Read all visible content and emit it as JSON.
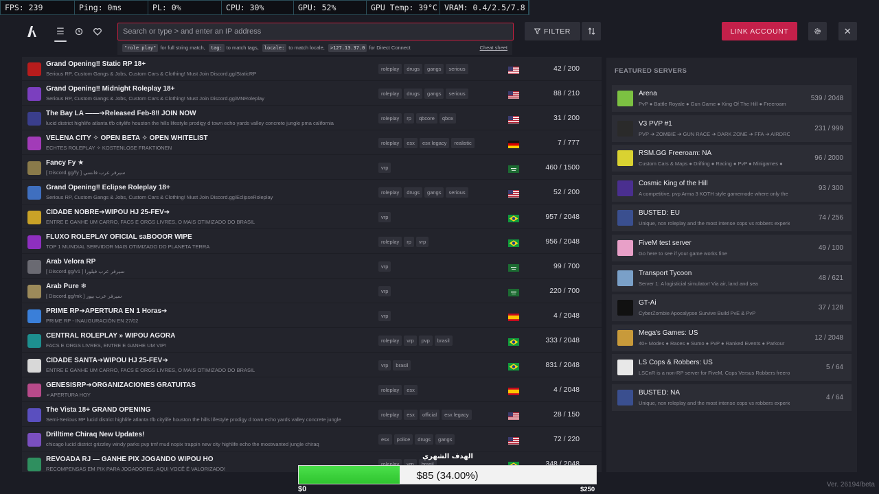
{
  "perf": [
    {
      "label": "FPS: 239"
    },
    {
      "label": "Ping: 0ms"
    },
    {
      "label": "PL: 0%"
    },
    {
      "label": "CPU: 30%"
    },
    {
      "label": "GPU: 52%"
    },
    {
      "label": "GPU Temp: 39°C"
    },
    {
      "label": "VRAM: 0.4/2.5/7.8 GB"
    }
  ],
  "search": {
    "placeholder": "Search or type > and enter an IP address",
    "value": "",
    "hints": {
      "code1": "\"role play\"",
      "text1": "for full string match,",
      "code2": "tag:",
      "text2": "to match tags,",
      "code3": "locale:",
      "text3": "to match locale,",
      "code4": ">127.13.37.0",
      "text4": "for Direct Connect",
      "cheat": "Cheat sheet"
    }
  },
  "toolbar": {
    "filter_label": "FILTER",
    "link_label": "LINK ACCOUNT"
  },
  "colors": {
    "accent": "#c4204a",
    "bg": "#1b1c24",
    "panel": "#23242c",
    "goal": "#3bd23b"
  },
  "servers": [
    {
      "name": "Grand Opening‼ Static RP 18+",
      "desc": "Serious RP, Custom Gangs & Jobs, Custom Cars & Clothing! Must Join Discord.gg/StaticRP",
      "tags": [
        "roleplay",
        "drugs",
        "gangs",
        "serious"
      ],
      "flag": "us",
      "players": "42 / 200",
      "icon": "#b81c1c"
    },
    {
      "name": "Grand Opening‼ Midnight Roleplay 18+",
      "desc": "Serious RP, Custom Gangs & Jobs, Custom Cars & Clothing! Must Join Discord.gg/MNRoleplay",
      "tags": [
        "roleplay",
        "drugs",
        "gangs",
        "serious"
      ],
      "flag": "us",
      "players": "88 / 210",
      "icon": "#7b3fbf"
    },
    {
      "name": "The Bay LA ——➔Released Feb-8‼ JOIN NOW",
      "desc": "lucid district highlife atlanta tfb citylife houston the hills lifestyle prodigy d town echo yards valley concrete jungle pma california",
      "tags": [
        "roleplay",
        "rp",
        "qbcore",
        "qbox"
      ],
      "flag": "us",
      "players": "31 / 200",
      "icon": "#3a3e8c"
    },
    {
      "name": "VELENA CITY ✧ OPEN BETA ✧ OPEN WHITELIST",
      "desc": "ECHTES ROLEPLAY ✧ KOSTENLOSE FRAKTIONEN",
      "tags": [
        "roleplay",
        "esx",
        "esx legacy",
        "realistic"
      ],
      "flag": "de",
      "players": "7 / 777",
      "icon": "#a23bb8"
    },
    {
      "name": "Fancy Fy ★",
      "desc": "[ Discord.gg/fy ] سيرفر عرب فانسي",
      "tags": [
        "vrp"
      ],
      "flag": "sa",
      "players": "460 / 1500",
      "icon": "#8a7a4a"
    },
    {
      "name": "Grand Opening‼ Eclipse Roleplay 18+",
      "desc": "Serious RP, Custom Gangs & Jobs, Custom Cars & Clothing! Must Join Discord.gg/EclipseRoleplay",
      "tags": [
        "roleplay",
        "drugs",
        "gangs",
        "serious"
      ],
      "flag": "us",
      "players": "52 / 200",
      "icon": "#3f6fbf"
    },
    {
      "name": "CIDADE NOBRE➔WIPOU HJ 25-FEV➔",
      "desc": "ENTRE E GANHE UM CARRO, FACS E ORGS LIVRES, O MAIS OTIMIZADO DO BRASIL",
      "tags": [
        "vrp"
      ],
      "flag": "br",
      "players": "957 / 2048",
      "icon": "#c9a227"
    },
    {
      "name": "FLUXO ROLEPLAY OFICIAL saBOOOR WIPE",
      "desc": "TOP 1 MUNDIAL SERVIDOR MAIS OTIMIZADO DO PLANETA TERRA",
      "tags": [
        "roleplay",
        "rp",
        "vrp"
      ],
      "flag": "br",
      "players": "956 / 2048",
      "icon": "#8e2fbf"
    },
    {
      "name": "Arab Velora RP",
      "desc": "[ Discord.gg/v1 ] سيرفر عرب فيلورا",
      "tags": [
        "vrp"
      ],
      "flag": "sa",
      "players": "99 / 700",
      "icon": "#6a6a72"
    },
    {
      "name": "Arab Pure ❄",
      "desc": "[ Discord.gg/mk ] سيرفر عرب بيور",
      "tags": [
        "vrp"
      ],
      "flag": "sa",
      "players": "220 / 700",
      "icon": "#9c8a5a"
    },
    {
      "name": "PRIME RP➔APERTURA EN 1 Horas➔",
      "desc": "PRIME RP - INAUGURACIÓN EN 27/02",
      "tags": [
        "vrp"
      ],
      "flag": "es",
      "players": "4 / 2048",
      "icon": "#3a7fd9"
    },
    {
      "name": "CENTRAL ROLEPLAY » WIPOU AGORA",
      "desc": "FACS E ORGS LIVRES, ENTRE E GANHE UM VIP!",
      "tags": [
        "roleplay",
        "vrp",
        "pvp",
        "brasil"
      ],
      "flag": "br",
      "players": "333 / 2048",
      "icon": "#1d8f8f"
    },
    {
      "name": "CIDADE SANTA➔WIPOU HJ 25-FEV➔",
      "desc": "ENTRE E GANHE UM CARRO, FACS E ORGS LIVRES, O MAIS OTIMIZADO DO BRASIL",
      "tags": [
        "vrp",
        "brasil"
      ],
      "flag": "br",
      "players": "831 / 2048",
      "icon": "#d8d8d8"
    },
    {
      "name": "GENESISRP➔ORGANIZACIONES GRATUITAS",
      "desc": "➢APERTURA HOY",
      "tags": [
        "roleplay",
        "esx"
      ],
      "flag": "es",
      "players": "4 / 2048",
      "icon": "#b74a8a"
    },
    {
      "name": "The Vista 18+ GRAND OPENING",
      "desc": "Semi-Serious RP lucid district highlife atlanta tfb citylife houston the hills lifestyle prodigy d town echo yards valley concrete jungle",
      "tags": [
        "roleplay",
        "esx",
        "official",
        "esx legacy"
      ],
      "flag": "us",
      "players": "28 / 150",
      "icon": "#5a4fbf"
    },
    {
      "name": "Drilltime Chiraq New Updates!",
      "desc": "chicago lucid district grizzley windy parks pvp tmf mud nopix trappin new city highlife echo the mostwanted jungle chiraq",
      "tags": [
        "esx",
        "police",
        "drugs",
        "gangs"
      ],
      "flag": "us",
      "players": "72 / 220",
      "icon": "#7a4fbf"
    },
    {
      "name": "REVOADA RJ — GANHE PIX JOGANDO WIPOU HO",
      "desc": "RECOMPENSAS EM PIX PARA JOGADORES, AQUI VOCÊ É VALORIZADO!",
      "tags": [
        "roleplay",
        "vrp",
        "brasil"
      ],
      "flag": "br",
      "players": "348 / 2048",
      "icon": "#2f8f5f"
    }
  ],
  "featured": {
    "title": "FEATURED SERVERS",
    "items": [
      {
        "name": "Arena",
        "desc": "PvP ● Battle Royale ● Gun Game ● King Of The Hill ● Freeroam",
        "players": "539 / 2048",
        "icon": "#7cc142"
      },
      {
        "name": "V3 PVP #1",
        "desc": "PVP ➔ ZOMBIE ➔ GUN RACE ➔ DARK ZONE ➔ FFA ➔ AIRDROP",
        "players": "231 / 999",
        "icon": "#2a2a2a"
      },
      {
        "name": "RSM.GG Freeroam: NA",
        "desc": "Custom Cars & Maps ● Drifting ● Racing ● PvP ● Minigames ●",
        "players": "96 / 2000",
        "icon": "#d9d231"
      },
      {
        "name": "Cosmic King of the Hill",
        "desc": "A competitive, pvp Arma 3 KOTH style gamemode where only the best",
        "players": "93 / 300",
        "icon": "#4a2f8f"
      },
      {
        "name": "BUSTED: EU",
        "desc": "Unique, non roleplay and the most intense cops vs robbers experience",
        "players": "74 / 256",
        "icon": "#3a4f8f"
      },
      {
        "name": "FiveM test server",
        "desc": "Go here to see if your game works fine",
        "players": "49 / 100",
        "icon": "#e8a0c8"
      },
      {
        "name": "Transport Tycoon",
        "desc": "Server 1: A logisticial simulator! Via air, land and sea",
        "players": "48 / 621",
        "icon": "#7aa0c8"
      },
      {
        "name": "GT-Ai",
        "desc": "CyberZombie Apocalypse Survive Build PvE & PvP",
        "players": "37 / 128",
        "icon": "#111111"
      },
      {
        "name": "Mega's Games: US",
        "desc": "40+ Modes ● Races ● Sumo ● PvP ● Ranked Events ● Parkour",
        "players": "12 / 2048",
        "icon": "#c89a3a"
      },
      {
        "name": "LS Cops & Robbers: US",
        "desc": "LSCnR is a non-RP server for FiveM, Cops Versus Robbers freeroam",
        "players": "5 / 64",
        "icon": "#e8e8e8"
      },
      {
        "name": "BUSTED: NA",
        "desc": "Unique, non roleplay and the most intense cops vs robbers experience",
        "players": "4 / 64",
        "icon": "#3a4f8f"
      }
    ]
  },
  "goal": {
    "label": "الهدف الشهري",
    "text": "$85 (34.00%)",
    "progress": 0.34,
    "min": "$0",
    "max": "$250"
  },
  "version": "Ver. 26194/beta"
}
